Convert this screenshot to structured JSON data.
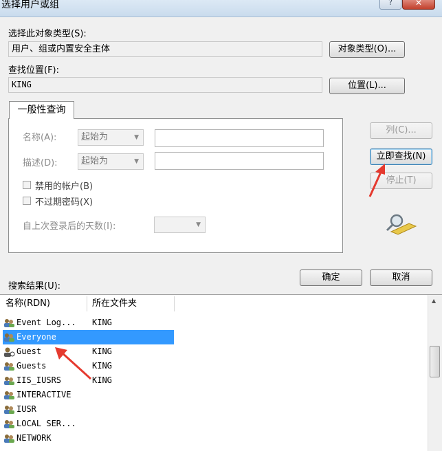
{
  "window": {
    "title": "选择用户或组",
    "help_label": "?",
    "close_label": "✕"
  },
  "object_types": {
    "label": "选择此对象类型(S):",
    "value": "用户、组或内置安全主体",
    "button": "对象类型(O)..."
  },
  "location": {
    "label": "查找位置(F):",
    "value": "KING",
    "button": "位置(L)..."
  },
  "query": {
    "tab_label": "一般性查询",
    "name": {
      "label": "名称(A):",
      "mode": "起始为",
      "value": ""
    },
    "description": {
      "label": "描述(D):",
      "mode": "起始为",
      "value": ""
    },
    "disabled_accounts": "禁用的帐户(B)",
    "no_expire_password": "不过期密码(X)",
    "days_since_login": {
      "label": "自上次登录后的天数(I):",
      "value": ""
    }
  },
  "side_buttons": {
    "columns": "列(C)...",
    "find_now": "立即查找(N)",
    "stop": "停止(T)"
  },
  "results": {
    "label": "搜索结果(U):",
    "ok": "确定",
    "cancel": "取消",
    "columns": [
      "名称(RDN)",
      "所在文件夹"
    ],
    "rows": [
      {
        "name": "Event Log...",
        "folder": "KING"
      },
      {
        "name": "Everyone",
        "folder": ""
      },
      {
        "name": "Guest",
        "folder": "KING"
      },
      {
        "name": "Guests",
        "folder": "KING"
      },
      {
        "name": "IIS_IUSRS",
        "folder": "KING"
      },
      {
        "name": "INTERACTIVE",
        "folder": ""
      },
      {
        "name": "IUSR",
        "folder": ""
      },
      {
        "name": "LOCAL SER...",
        "folder": ""
      },
      {
        "name": "NETWORK",
        "folder": ""
      }
    ],
    "selected_row": "Everyone"
  },
  "colors": {
    "selection": "#3399ff",
    "annotation_arrow": "#e53a2f"
  }
}
